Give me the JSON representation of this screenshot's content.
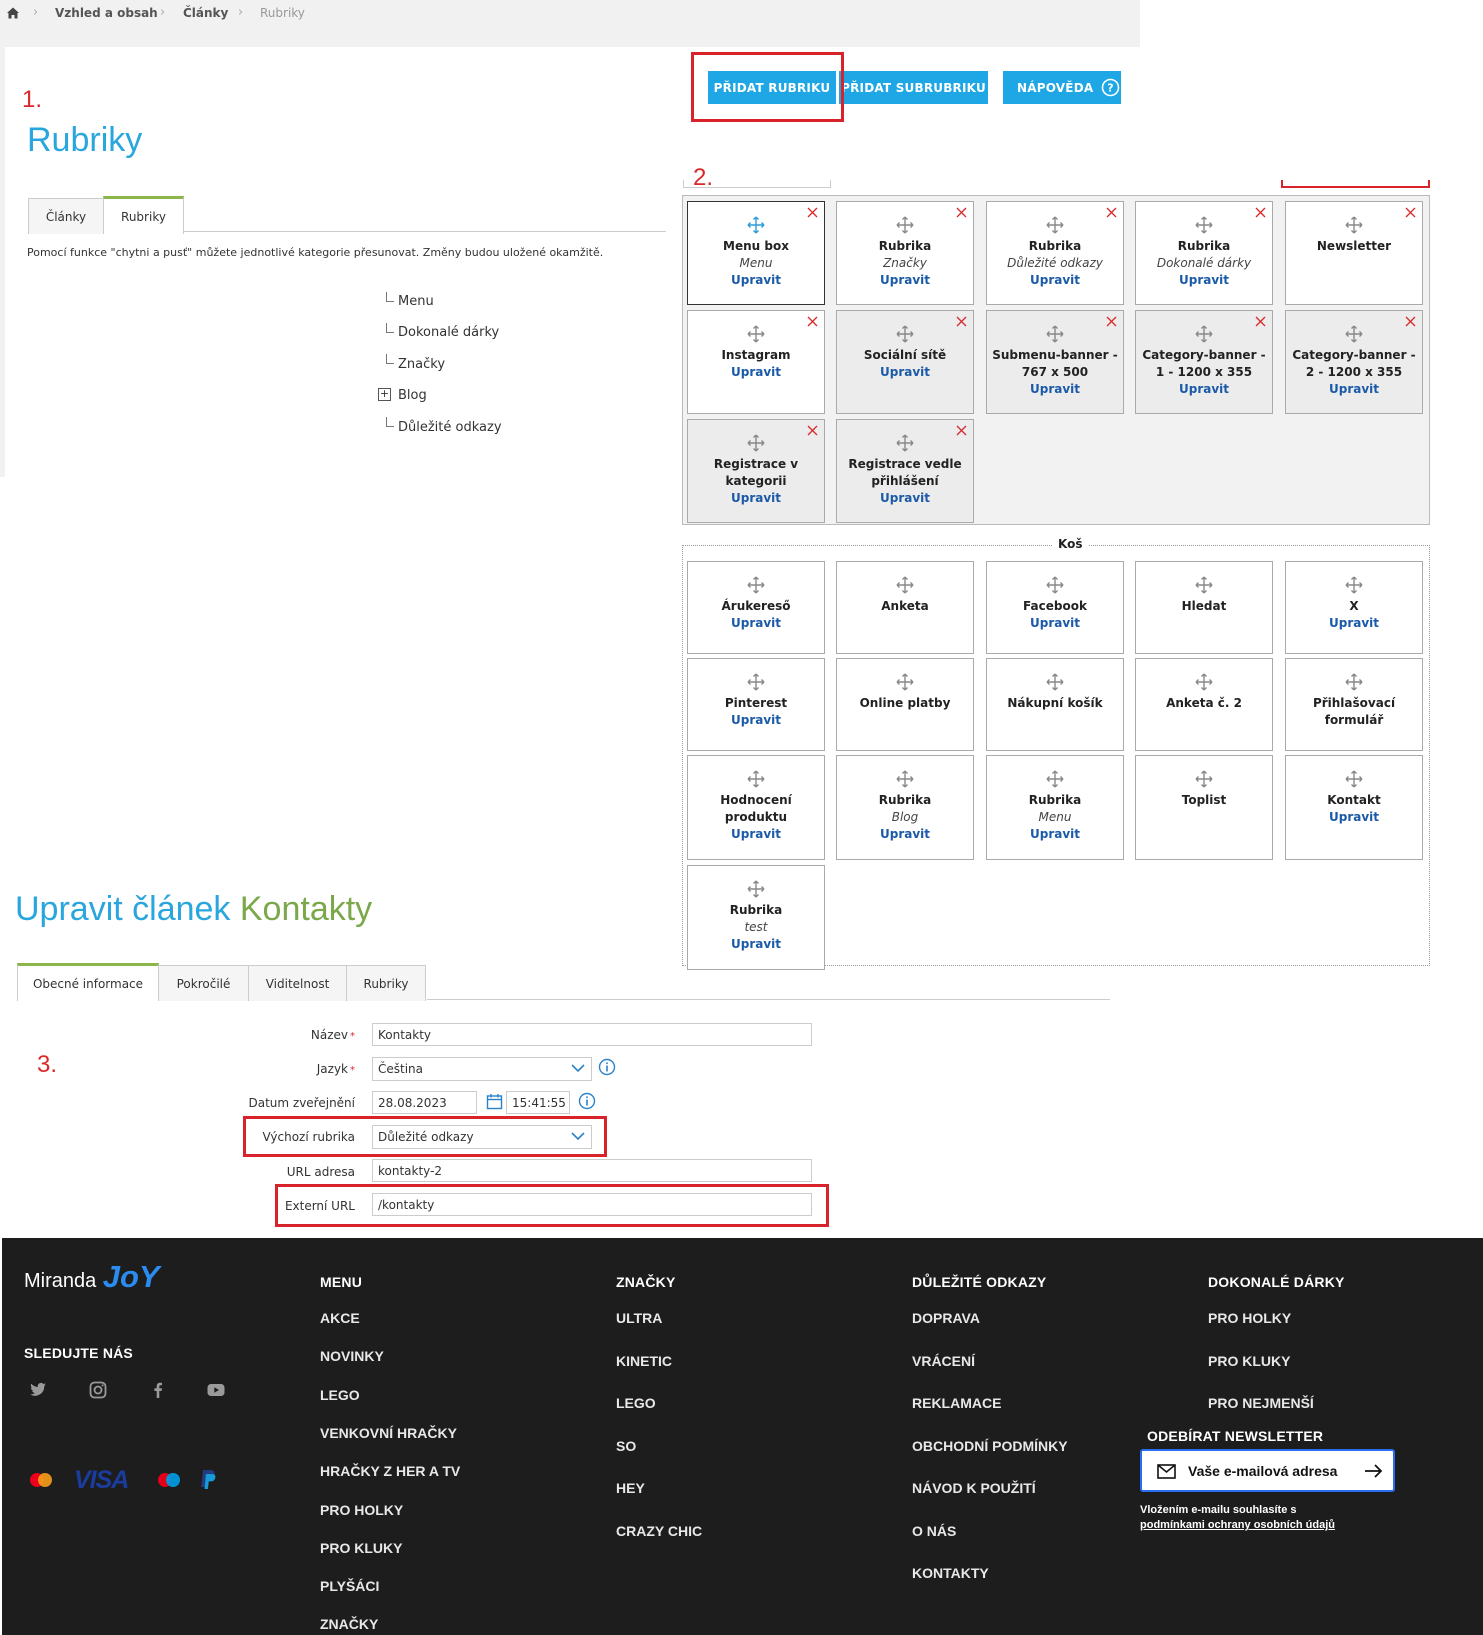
{
  "breadcrumb": [
    "Vzhled a obsah",
    "Články",
    "Rubriky"
  ],
  "steps": [
    "1.",
    "2.",
    "3."
  ],
  "rubriky_page": {
    "title": "Rubriky",
    "tabs": [
      "Články",
      "Rubriky"
    ],
    "description": "Pomocí funkce \"chytni a pusť\" můžete jednotlivé kategorie přesunovat. Změny budou uložené okamžitě.",
    "buttons": {
      "add_rubric": "PŘIDAT RUBRIKU",
      "add_subrubric": "PŘIDAT SUBRUBRIKU",
      "help": "NÁPOVĚDA"
    },
    "tree": [
      {
        "label": "Menu",
        "expandable": false
      },
      {
        "label": "Dokonalé dárky",
        "expandable": false
      },
      {
        "label": "Značky",
        "expandable": false
      },
      {
        "label": "Blog",
        "expandable": true
      },
      {
        "label": "Důležité odkazy",
        "expandable": false
      }
    ]
  },
  "layout_boxes": {
    "active": [
      {
        "title": "Menu box",
        "sub": "Menu",
        "edit": "Upravit",
        "removable": true,
        "selected": true
      },
      {
        "title": "Rubrika",
        "sub": "Značky",
        "edit": "Upravit",
        "removable": true
      },
      {
        "title": "Rubrika",
        "sub": "Důležité odkazy",
        "edit": "Upravit",
        "removable": true
      },
      {
        "title": "Rubrika",
        "sub": "Dokonalé dárky",
        "edit": "Upravit",
        "removable": true
      },
      {
        "title": "Newsletter",
        "removable": true
      },
      {
        "title": "Instagram",
        "edit": "Upravit",
        "removable": true
      },
      {
        "title": "Sociální sítě",
        "edit": "Upravit",
        "removable": true,
        "grey": true
      },
      {
        "title": "Submenu-banner - 767 x 500",
        "edit": "Upravit",
        "removable": true,
        "grey": true
      },
      {
        "title": "Category-banner - 1 - 1200 x 355",
        "edit": "Upravit",
        "removable": true,
        "grey": true
      },
      {
        "title": "Category-banner - 2 - 1200 x 355",
        "edit": "Upravit",
        "removable": true,
        "grey": true
      },
      {
        "title": "Registrace v kategorii",
        "edit": "Upravit",
        "removable": true,
        "grey": true
      },
      {
        "title": "Registrace vedle přihlášení",
        "edit": "Upravit",
        "removable": true,
        "grey": true
      }
    ],
    "trash_label": "Koš",
    "trash": [
      {
        "title": "Árukereső",
        "edit": "Upravit"
      },
      {
        "title": "Anketa"
      },
      {
        "title": "Facebook",
        "edit": "Upravit"
      },
      {
        "title": "Hledat"
      },
      {
        "title": "X",
        "edit": "Upravit"
      },
      {
        "title": "Pinterest",
        "edit": "Upravit"
      },
      {
        "title": "Online platby"
      },
      {
        "title": "Nákupní košík"
      },
      {
        "title": "Anketa č. 2"
      },
      {
        "title": "Přihlašovací formulář"
      },
      {
        "title": "Hodnocení produktu",
        "edit": "Upravit"
      },
      {
        "title": "Rubrika",
        "sub": "Blog",
        "edit": "Upravit"
      },
      {
        "title": "Rubrika",
        "sub": "Menu",
        "edit": "Upravit"
      },
      {
        "title": "Toplist"
      },
      {
        "title": "Kontakt",
        "edit": "Upravit"
      },
      {
        "title": "Rubrika",
        "sub": "test",
        "edit": "Upravit"
      }
    ]
  },
  "edit_article": {
    "title_prefix": "Upravit článek",
    "title_name": "Kontakty",
    "tabs": [
      "Obecné informace",
      "Pokročilé",
      "Viditelnost",
      "Rubriky"
    ],
    "fields": {
      "nazev_label": "Název",
      "nazev": "Kontakty",
      "jazyk_label": "Jazyk",
      "jazyk": "Čeština",
      "datum_label": "Datum zveřejnění",
      "datum": "28.08.2023",
      "cas": "15:41:55",
      "rubrika_label": "Výchozí rubrika",
      "rubrika": "Důležité odkazy",
      "url_label": "URL adresa",
      "url": "kontakty-2",
      "ext_label": "Externí URL",
      "ext": "/kontakty"
    }
  },
  "footer": {
    "brand": "Miranda",
    "brand_mark": "JoY",
    "follow": "SLEDUJTE NÁS",
    "social_icons": [
      "twitter-icon",
      "instagram-icon",
      "facebook-icon",
      "youtube-icon"
    ],
    "payment_icons": [
      "mastercard-icon",
      "visa-icon",
      "maestro-icon",
      "paypal-icon"
    ],
    "visa_text": "VISA",
    "columns": [
      {
        "title": "MENU",
        "items": [
          "AKCE",
          "NOVINKY",
          "LEGO",
          "VENKOVNÍ HRAČKY",
          "HRAČKY Z HER A TV",
          "PRO HOLKY",
          "PRO KLUKY",
          "PLYŠÁCI",
          "ZNAČKY"
        ]
      },
      {
        "title": "ZNAČKY",
        "items": [
          "ULTRA",
          "KINETIC",
          "LEGO",
          "SO",
          "HEY",
          "CRAZY CHIC"
        ]
      },
      {
        "title": "DŮLEŽITÉ ODKAZY",
        "items": [
          "DOPRAVA",
          "VRÁCENÍ",
          "REKLAMACE",
          "OBCHODNÍ PODMÍNKY",
          "NÁVOD K POUŽITÍ",
          "O NÁS",
          "KONTAKTY"
        ]
      },
      {
        "title": "DOKONALÉ DÁRKY",
        "items": [
          "PRO HOLKY",
          "PRO KLUKY",
          "PRO NEJMENŠÍ"
        ]
      }
    ],
    "newsletter_title": "ODEBÍRAT NEWSLETTER",
    "newsletter_placeholder": "Vaše e-mailová adresa",
    "newsletter_note": "Vložením e-mailu souhlasíte s",
    "newsletter_link": "podmínkami ochrany osobních údajů"
  }
}
